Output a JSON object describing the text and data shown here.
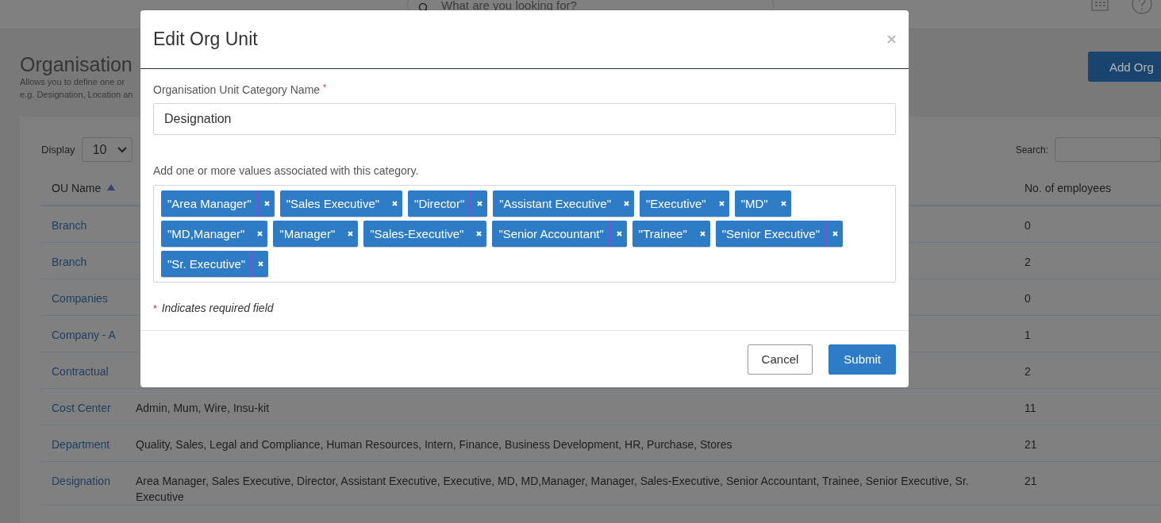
{
  "top_bar": {
    "search": {
      "placeholder": "What are you looking for?"
    }
  },
  "page": {
    "title": "Organisation",
    "description": [
      "Allows you to define one or",
      "e.g. Designation, Location an"
    ],
    "add_button": "Add Org"
  },
  "table_controls": {
    "display_label": "Display",
    "page_size": "10",
    "search_label": "Search:"
  },
  "table": {
    "columns": [
      {
        "label": "OU Name",
        "sorted": true
      },
      {
        "label": "No. of employees",
        "sorted": false
      }
    ],
    "rows": [
      {
        "name": "Branch",
        "employees": "0"
      },
      {
        "name": "Branch",
        "employees": "2"
      },
      {
        "name": "Companies",
        "employees": "0"
      },
      {
        "name": "Company - A",
        "employees": "1"
      },
      {
        "name": "Contractual",
        "employees": "2"
      },
      {
        "name": "Cost Center",
        "values": "Admin, Mum, Wire, Insu-kit",
        "employees": "11"
      },
      {
        "name": "Department",
        "values": "Quality, Sales, Legal and Compliance, Human Resources, Intern, Finance, Business Development, HR, Purchase, Stores",
        "employees": "21"
      },
      {
        "name": "Designation",
        "values": "Area Manager, Sales Executive, Director, Assistant Executive, Executive, MD, MD,Manager, Manager, Sales-Executive, Senior Accountant, Trainee, Senior Executive, Sr. Executive",
        "employees": "21"
      }
    ]
  },
  "modal": {
    "title": "Edit Org Unit",
    "field_label": "Organisation Unit Category Name",
    "required_mark": "*",
    "field_value": "Designation",
    "values_label": "Add one or more values associated with this category.",
    "tags": [
      "\"Area Manager\"",
      "\"Sales Executive\"",
      "\"Director\"",
      "\"Assistant Executive\"",
      "\"Executive\"",
      "\"MD\"",
      "\"MD,Manager\"",
      "\"Manager\"",
      "\"Sales-Executive\"",
      "\"Senior Accountant\"",
      "\"Trainee\"",
      "\"Senior Executive\"",
      "\"Sr. Executive\""
    ],
    "required_note_mark": "*",
    "required_note": "Indicates required field",
    "buttons": [
      {
        "label": "Cancel",
        "kind": "secondary"
      },
      {
        "label": "Submit",
        "kind": "primary"
      }
    ]
  }
}
